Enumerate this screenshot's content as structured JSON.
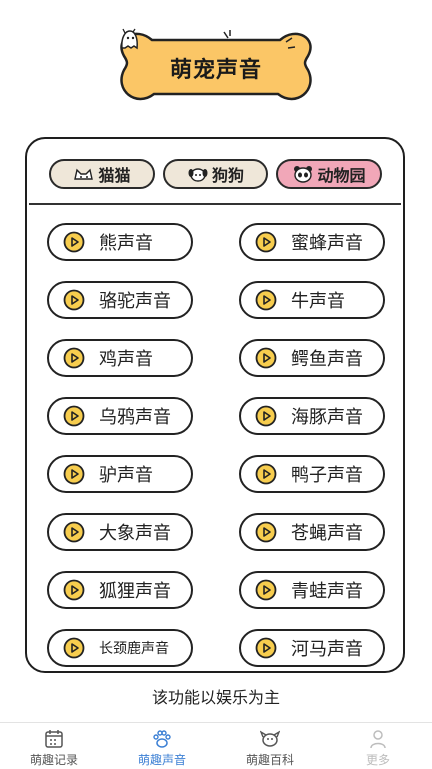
{
  "header": {
    "title": "萌宠声音"
  },
  "tabs": [
    {
      "label": "猫猫",
      "icon": "cat-icon",
      "active": false
    },
    {
      "label": "狗狗",
      "icon": "dog-icon",
      "active": false
    },
    {
      "label": "动物园",
      "icon": "panda-icon",
      "active": true
    }
  ],
  "sounds": [
    "熊声音",
    "蜜蜂声音",
    "骆驼声音",
    "牛声音",
    "鸡声音",
    "鳄鱼声音",
    "乌鸦声音",
    "海豚声音",
    "驴声音",
    "鸭子声音",
    "大象声音",
    "苍蝇声音",
    "狐狸声音",
    "青蛙声音",
    "长颈鹿声音",
    "河马声音"
  ],
  "footer_note": "该功能以娱乐为主",
  "nav": [
    {
      "label": "萌趣记录",
      "icon": "calendar-icon"
    },
    {
      "label": "萌趣声音",
      "icon": "paw-icon",
      "active": true
    },
    {
      "label": "萌趣百科",
      "icon": "dog-face-icon"
    },
    {
      "label": "更多",
      "icon": "person-icon",
      "dim": true
    }
  ],
  "colors": {
    "bone": "#fbc666",
    "tab_bg": "#efe7d9",
    "tab_active_bg": "#f1a7b8",
    "play_fill": "#f7cd4e",
    "nav_active": "#3b7fd4"
  }
}
